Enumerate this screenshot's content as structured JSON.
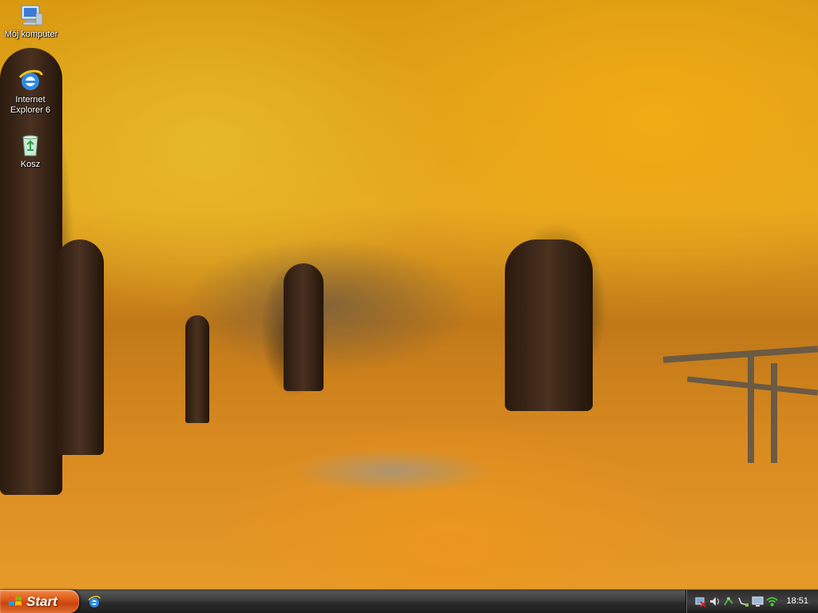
{
  "desktop": {
    "icons": [
      {
        "label": "Mój komputer",
        "icon": "my-computer-icon"
      },
      {
        "label": "Internet Explorer 6",
        "icon": "internet-explorer-icon"
      },
      {
        "label": "Kosz",
        "icon": "recycle-bin-icon"
      }
    ]
  },
  "taskbar": {
    "start_label": "Start",
    "quick_launch": [
      {
        "icon": "internet-explorer-icon"
      }
    ],
    "tray": {
      "icons": [
        "network-error-icon",
        "audio-icon",
        "connection-icon",
        "network-icon",
        "monitor-icon",
        "wireless-icon"
      ],
      "clock": "18:51"
    }
  },
  "colors": {
    "start_button": "#e05a18",
    "taskbar": "#3c3c3c",
    "wallpaper_foliage": "#e6a820"
  }
}
